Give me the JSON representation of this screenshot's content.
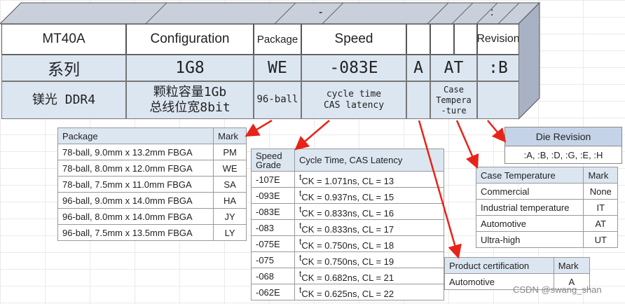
{
  "header": {
    "separator_dash": "-",
    "separator_colon": ":",
    "cols": [
      "MT40A",
      "Configuration",
      "Package",
      "Speed",
      "",
      "",
      "",
      "Revision"
    ]
  },
  "row1": [
    "系列",
    "1G8",
    "WE",
    "-083E",
    "A",
    "AT",
    ":B"
  ],
  "row2": {
    "series": "镁光 DDR4",
    "config_line1": "颗粒容量1Gb",
    "config_line2": "总线位宽8bit",
    "package": "96-ball",
    "speed_line1": "cycle time",
    "speed_line2": "CAS latency",
    "temp_line1": "Case",
    "temp_line2": "Tempera",
    "temp_line3": "-ture"
  },
  "package_table": {
    "headers": [
      "Package",
      "Mark"
    ],
    "rows": [
      [
        "78-ball, 9.0mm x 13.2mm FBGA",
        "PM"
      ],
      [
        "78-ball, 8.0mm x 12.0mm FBGA",
        "WE"
      ],
      [
        "78-ball, 7.5mm x 11.0mm FBGA",
        "SA"
      ],
      [
        "96-ball, 9.0mm x 14.0mm FBGA",
        "HA"
      ],
      [
        "96-ball, 8.0mm x 14.0mm FBGA",
        "JY"
      ],
      [
        "96-ball, 7.5mm x 13.5mm FBGA",
        "LY"
      ]
    ]
  },
  "speed_table": {
    "header_grade": "Speed Grade",
    "header_cycle": "Cycle Time, CAS Latency",
    "sup": "t",
    "rows": [
      [
        "-107E",
        "CK = 1.071ns, CL = 13"
      ],
      [
        "-093E",
        "CK = 0.937ns, CL = 15"
      ],
      [
        "-083E",
        "CK = 0.833ns, CL = 16"
      ],
      [
        "-083",
        "CK = 0.833ns, CL = 17"
      ],
      [
        "-075E",
        "CK = 0.750ns, CL = 18"
      ],
      [
        "-075",
        "CK = 0.750ns, CL = 19"
      ],
      [
        "-068",
        "CK = 0.682ns, CL = 21"
      ],
      [
        "-062E",
        "CK = 0.625ns, CL = 22"
      ]
    ]
  },
  "die_revision": {
    "title": "Die Revision",
    "values": ":A, :B, :D, :G, :E, :H"
  },
  "case_temp_table": {
    "headers": [
      "Case Temperature",
      "Mark"
    ],
    "rows": [
      [
        "Commercial",
        "None"
      ],
      [
        "Industrial temperature",
        "IT"
      ],
      [
        "Automotive",
        "AT"
      ],
      [
        "Ultra-high",
        "UT"
      ]
    ]
  },
  "product_cert_table": {
    "headers": [
      "Product certification",
      "Mark"
    ],
    "rows": [
      [
        "Automotive",
        "A"
      ]
    ]
  },
  "watermark": "CSDN @swang_shan",
  "colors": {
    "light_blue": "#dce6f1",
    "arrow_red": "#e8231a",
    "top_strip": "#b7bfcf"
  }
}
